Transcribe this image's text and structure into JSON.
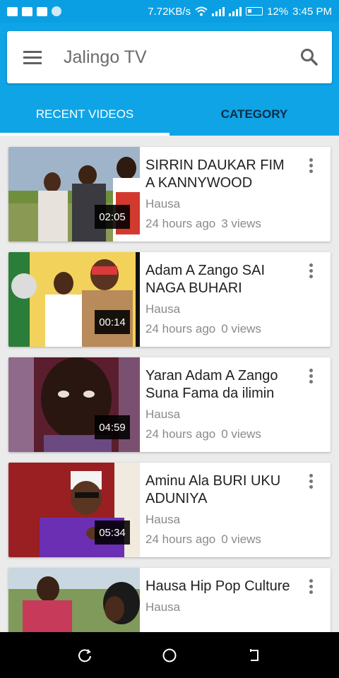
{
  "status_bar": {
    "speed": "7.72KB/s",
    "battery": "12%",
    "time": "3:45 PM"
  },
  "header": {
    "title": "Jalingo TV"
  },
  "tabs": [
    {
      "label": "RECENT VIDEOS",
      "active": true
    },
    {
      "label": "CATEGORY",
      "active": false
    }
  ],
  "videos": [
    {
      "title": "SIRRIN DAUKAR FIM A KANNYWOOD",
      "channel": "Hausa",
      "time_ago": "24 hours ago",
      "views": "3 views",
      "duration": "02:05"
    },
    {
      "title": "Adam A Zango SAI NAGA BUHARI",
      "channel": "Hausa",
      "time_ago": "24 hours ago",
      "views": "0 views",
      "duration": "00:14"
    },
    {
      "title": "Yaran Adam A Zango Suna Fama da ilimin",
      "channel": "Hausa",
      "time_ago": "24 hours ago",
      "views": "0 views",
      "duration": "04:59"
    },
    {
      "title": "Aminu Ala BURI UKU ADUNIYA",
      "channel": "Hausa",
      "time_ago": "24 hours ago",
      "views": "0 views",
      "duration": "05:34"
    },
    {
      "title": "Hausa Hip Pop Culture",
      "channel": "Hausa",
      "time_ago": "",
      "views": "",
      "duration": ""
    }
  ],
  "colors": {
    "primary": "#0fa4e6",
    "tab_inactive_text": "#0b2c45"
  }
}
